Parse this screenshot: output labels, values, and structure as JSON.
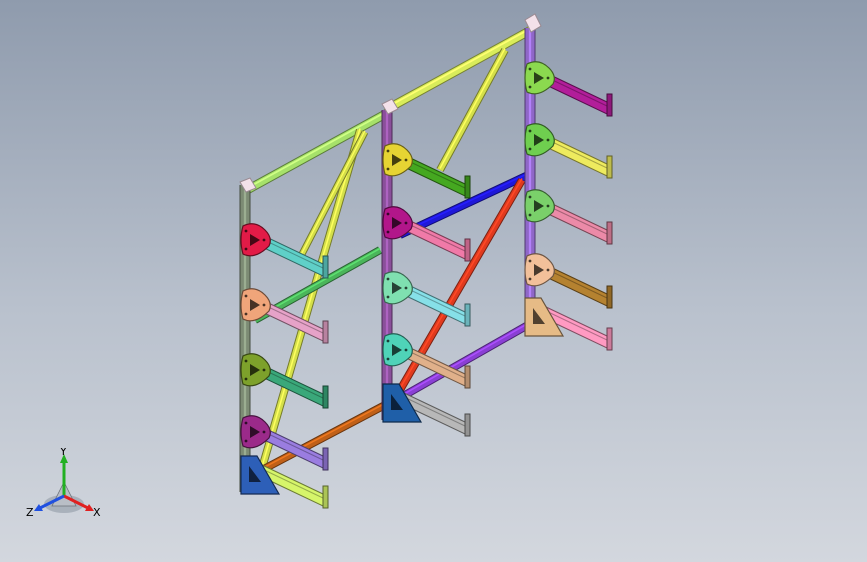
{
  "viewport": {
    "background_top": "#8f9bad",
    "background_bottom": "#d3d7de"
  },
  "model": {
    "description_icon": "cantilever-rack-3d-model",
    "upright_colors": [
      "#7c8b74",
      "#8a4f9a",
      "#8f67c8"
    ],
    "top_beam_colors": [
      "#a6e16a",
      "#d9ec5a"
    ],
    "brace_colors": [
      "#d4df4a",
      "#e03a1e",
      "#1f18d8",
      "#4ab55a",
      "#c06018",
      "#8a3fd4"
    ],
    "plate_colors": [
      "#e21b47",
      "#f0a57a",
      "#7da12b",
      "#9b2a8a",
      "#2d5fb8",
      "#e6d433",
      "#b2168a",
      "#7fe0b0",
      "#4fd3b8",
      "#1f5fa8",
      "#8bd94f",
      "#6fcf4f",
      "#7ad06a",
      "#f2c09a",
      "#e6bb86",
      "#3fbf4f"
    ],
    "arm_colors": [
      "#5fd0c8",
      "#e6a2c8",
      "#3aa87a",
      "#9a7de0",
      "#d6f56a",
      "#45a820",
      "#f07aa8",
      "#86e0e8",
      "#e0b08a",
      "#b8b8b8",
      "#b21e9a",
      "#eeeb5e",
      "#ec8aa8",
      "#b58230",
      "#ff9ac2",
      "#68d0d0"
    ]
  },
  "triad": {
    "x_label": "X",
    "y_label": "Y",
    "z_label": "Z",
    "x_color": "#e02020",
    "y_color": "#22b022",
    "z_color": "#2050e0"
  }
}
